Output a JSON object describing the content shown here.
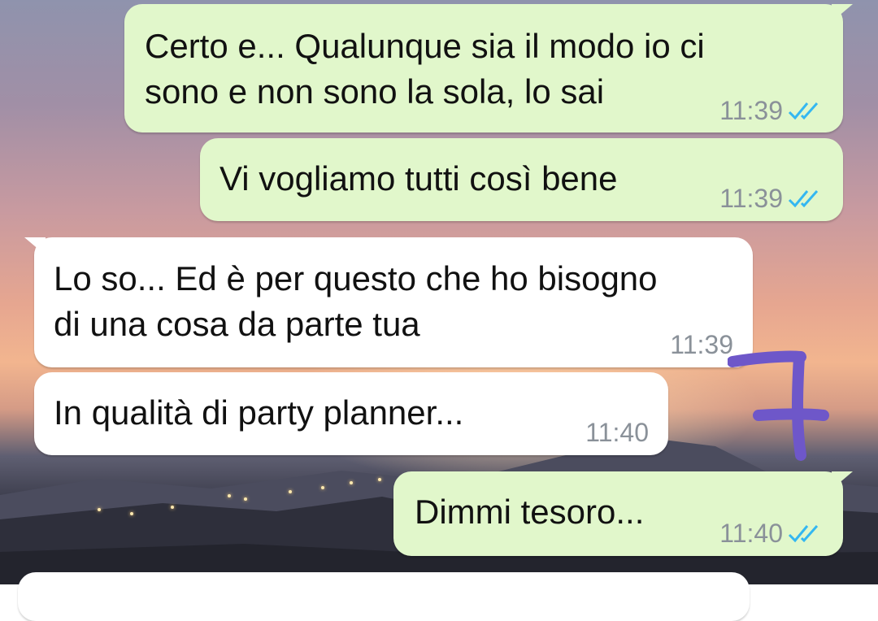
{
  "messages": [
    {
      "direction": "outgoing",
      "text": "Certo e... Qualunque sia il modo io ci\nsono e non sono la sola, lo sai",
      "time": "11:39",
      "status": "read"
    },
    {
      "direction": "outgoing",
      "text": "Vi vogliamo tutti così bene",
      "time": "11:39",
      "status": "read"
    },
    {
      "direction": "incoming",
      "text": "Lo so... Ed è per questo che ho bisogno\ndi una cosa da parte tua",
      "time": "11:39"
    },
    {
      "direction": "incoming",
      "text": "In qualità di party planner...",
      "time": "11:40"
    },
    {
      "direction": "outgoing",
      "text": "Dimmi tesoro...",
      "time": "11:40",
      "status": "read"
    }
  ],
  "annotation": {
    "text": "7",
    "color": "#6e57c9"
  },
  "colors": {
    "outgoing_bubble": "#e1f7cb",
    "incoming_bubble": "#ffffff",
    "read_ticks": "#34b7f1",
    "timestamp": "#8a9199"
  },
  "icons": {
    "read_receipt": "double-check-icon"
  }
}
